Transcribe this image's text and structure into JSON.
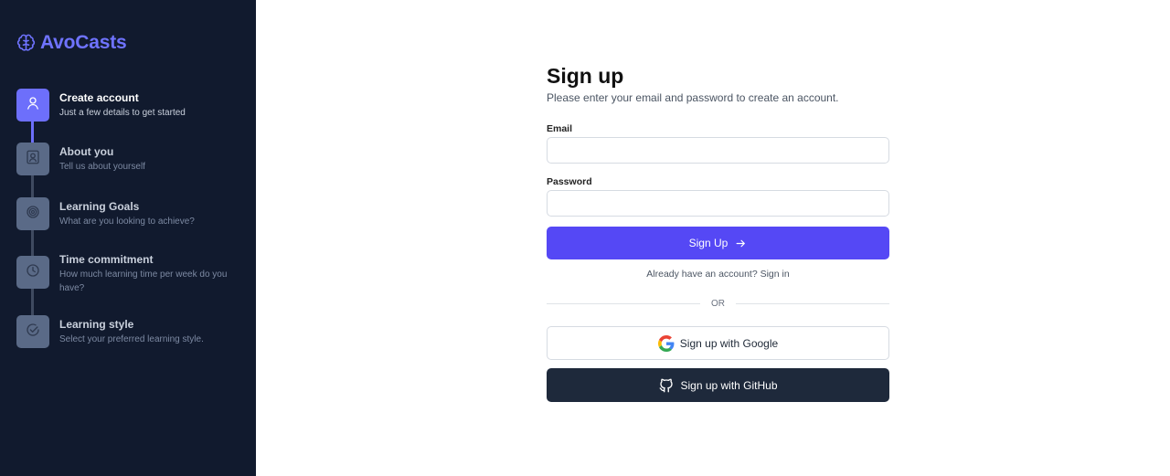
{
  "brand": {
    "name": "AvoCasts",
    "icon": "brain-icon",
    "color": "#6f73ff"
  },
  "steps": [
    {
      "title": "Create account",
      "subtitle": "Just a few details to get started",
      "icon": "user-icon",
      "active": true
    },
    {
      "title": "About you",
      "subtitle": "Tell us about yourself",
      "icon": "profile-card-icon",
      "active": false
    },
    {
      "title": "Learning Goals",
      "subtitle": "What are you looking to achieve?",
      "icon": "target-icon",
      "active": false
    },
    {
      "title": "Time commitment",
      "subtitle": "How much learning time per week do you have?",
      "icon": "clock-icon",
      "active": false
    },
    {
      "title": "Learning style",
      "subtitle": "Select your preferred learning style.",
      "icon": "check-circle-icon",
      "active": false
    }
  ],
  "form": {
    "title": "Sign up",
    "subtitle": "Please enter your email and password to create an account.",
    "email_label": "Email",
    "email_value": "",
    "email_placeholder": "",
    "password_label": "Password",
    "password_value": "",
    "password_placeholder": "",
    "submit_label": "Sign Up",
    "signin_text": "Already have an account? Sign in",
    "or_text": "OR",
    "google_label": "Sign up with Google",
    "github_label": "Sign up with GitHub"
  },
  "colors": {
    "sidebar_bg": "#111a2e",
    "accent": "#6d6ffb",
    "primary_button": "#5548f5",
    "github_button": "#1e293b"
  }
}
